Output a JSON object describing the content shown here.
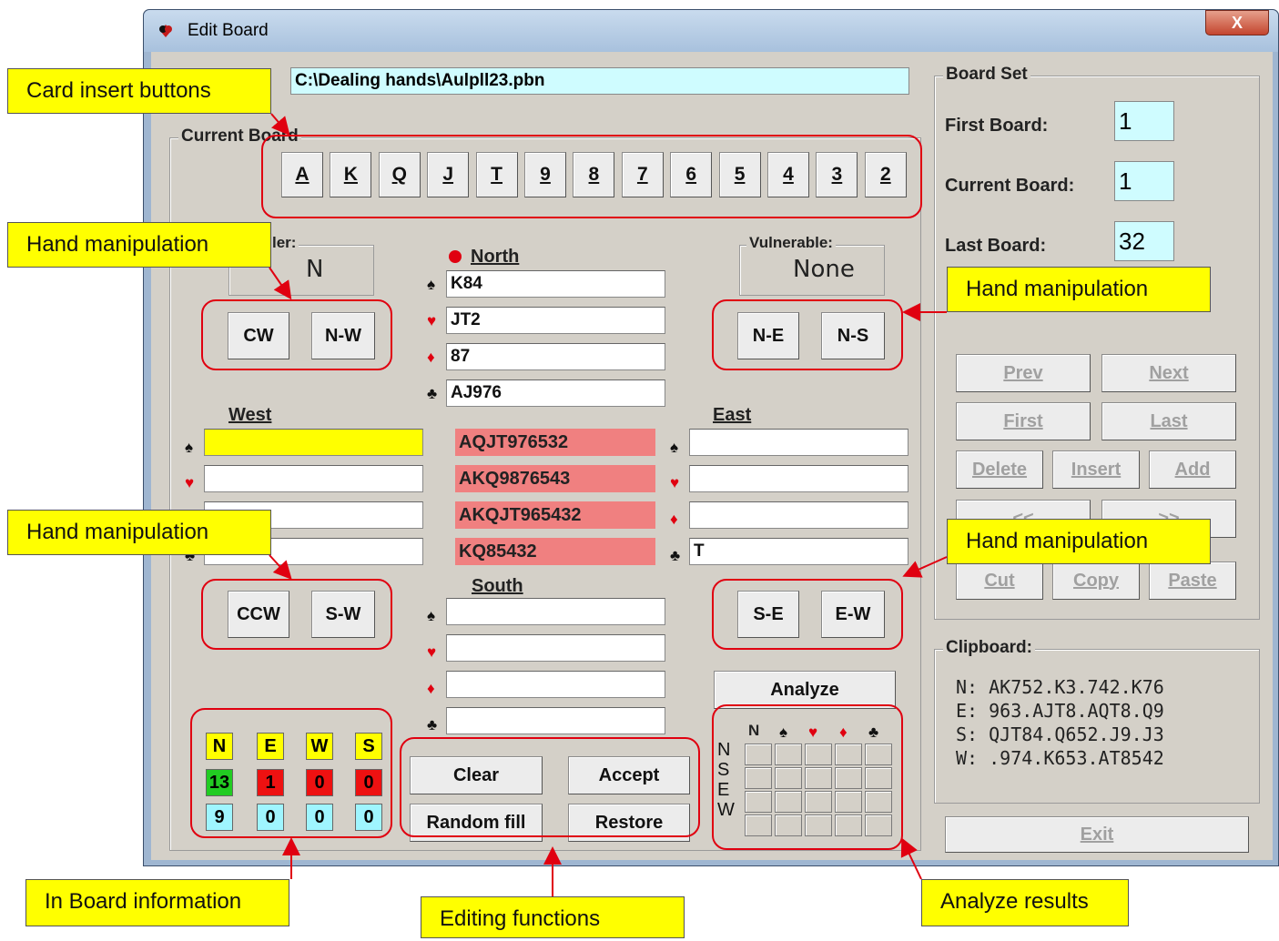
{
  "window": {
    "title": "Edit Board",
    "close_label": "X"
  },
  "file_path": "C:\\Dealing  hands\\Aulpll23.pbn",
  "current_board_group": "Current Board",
  "card_buttons": [
    "A",
    "K",
    "Q",
    "J",
    "T",
    "9",
    "8",
    "7",
    "6",
    "5",
    "4",
    "3",
    "2"
  ],
  "dealer": {
    "label": "ler:",
    "value": "N"
  },
  "vulnerable": {
    "label": "Vulnerable:",
    "value": "None"
  },
  "hand_buttons": {
    "cw": "CW",
    "nw": "N-W",
    "ne": "N-E",
    "ns": "N-S",
    "ccw": "CCW",
    "sw": "S-W",
    "se": "S-E",
    "ew": "E-W"
  },
  "north": {
    "label": "North",
    "spades": "K84",
    "hearts": "JT2",
    "diamonds": "87",
    "clubs": "AJ976"
  },
  "west": {
    "label": "West",
    "spades": "",
    "hearts": "",
    "diamonds": "",
    "clubs": ""
  },
  "east": {
    "label": "East",
    "spades": "",
    "hearts": "",
    "diamonds": "",
    "clubs": "T"
  },
  "south": {
    "label": "South",
    "spades": "",
    "hearts": "",
    "diamonds": "",
    "clubs": ""
  },
  "remaining": [
    "AQJT976532",
    "AKQ9876543",
    "AKQJT965432",
    "KQ85432"
  ],
  "suit_symbols": {
    "spade": "♠",
    "heart": "♥",
    "diamond": "♦",
    "club": "♣"
  },
  "info_table": {
    "headers": [
      "N",
      "E",
      "W",
      "S"
    ],
    "row1": [
      "13",
      "1",
      "0",
      "0"
    ],
    "row2": [
      "9",
      "0",
      "0",
      "0"
    ]
  },
  "edit_buttons": {
    "clear": "Clear",
    "accept": "Accept",
    "random": "Random fill",
    "restore": "Restore"
  },
  "analyze": {
    "label": "Analyze",
    "header_n": "N",
    "rows": [
      "N",
      "S",
      "E",
      "W"
    ]
  },
  "board_set": {
    "title": "Board Set",
    "first_label": "First Board:",
    "first_value": "1",
    "current_label": "Current Board:",
    "current_value": "1",
    "last_label": "Last Board:",
    "last_value": "32"
  },
  "nav_buttons": {
    "prev": "Prev",
    "next": "Next",
    "first": "First",
    "last": "Last",
    "delete": "Delete",
    "insert": "Insert",
    "add": "Add",
    "back": "<<",
    "fwd": ">>",
    "cut": "Cut",
    "copy": "Copy",
    "paste": "Paste"
  },
  "clipboard": {
    "title": "Clipboard:",
    "lines": [
      "N: AK752.K3.742.K76",
      "E: 963.AJT8.AQT8.Q9",
      "S: QJT84.Q652.J9.J3",
      "W: .974.K653.AT8542"
    ]
  },
  "exit_label": "Exit",
  "callouts": {
    "card_insert": "Card insert buttons",
    "hand_manip": "Hand manipulation",
    "in_board": "In Board information",
    "editing": "Editing functions",
    "analyze": "Analyze results"
  },
  "colors": {
    "accent_red": "#e00010",
    "callout_yellow": "#ffff00",
    "pink": "#f08080",
    "cyan": "#cffcff"
  }
}
